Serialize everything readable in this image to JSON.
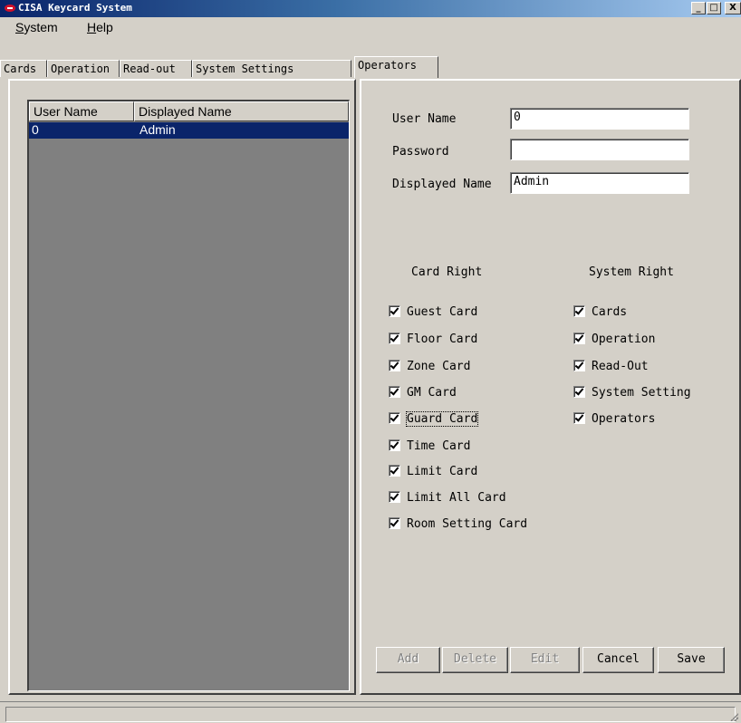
{
  "window": {
    "title": "CISA Keycard System",
    "minimize": "_",
    "maximize": "□",
    "close": "X"
  },
  "menu": [
    {
      "label": "System",
      "accel": "S",
      "rest": "ystem"
    },
    {
      "label": "Help",
      "accel": "H",
      "rest": "elp"
    }
  ],
  "tabs": [
    "Cards",
    "Operation",
    "Read-out",
    "System Settings",
    "Operators"
  ],
  "active_tab": "Operators",
  "list": {
    "columns": [
      "User Name",
      "Displayed Name"
    ],
    "rows": [
      {
        "user_name": "0",
        "displayed_name": "Admin",
        "selected": true
      }
    ]
  },
  "form": {
    "user_name_label": "User Name",
    "user_name_value": "0",
    "password_label": "Password",
    "password_value": "",
    "displayed_name_label": "Displayed Name",
    "displayed_name_value": "Admin"
  },
  "card_right": {
    "heading": "Card Right",
    "items": [
      {
        "label": "Guest Card",
        "checked": true
      },
      {
        "label": "Floor Card",
        "checked": true
      },
      {
        "label": "Zone Card",
        "checked": true
      },
      {
        "label": "GM Card",
        "checked": true
      },
      {
        "label": "Guard Card",
        "checked": true,
        "focused": true
      },
      {
        "label": "Time Card",
        "checked": true
      },
      {
        "label": "Limit Card",
        "checked": true
      },
      {
        "label": "Limit All Card",
        "checked": true
      },
      {
        "label": "Room Setting Card",
        "checked": true
      }
    ]
  },
  "system_right": {
    "heading": "System Right",
    "items": [
      {
        "label": "Cards",
        "checked": true
      },
      {
        "label": "Operation",
        "checked": true
      },
      {
        "label": "Read-Out",
        "checked": true
      },
      {
        "label": "System Setting",
        "checked": true
      },
      {
        "label": "Operators",
        "checked": true
      }
    ]
  },
  "buttons": {
    "add": "Add",
    "delete": "Delete",
    "edit": "Edit",
    "cancel": "Cancel",
    "save": "Save"
  }
}
